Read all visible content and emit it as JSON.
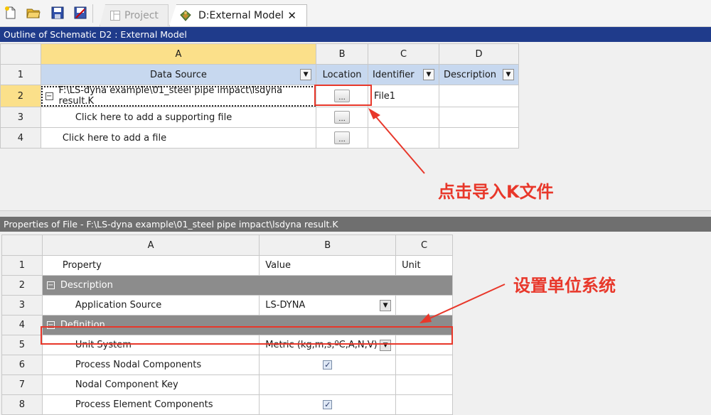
{
  "toolbar": {
    "icons": [
      "new-file-icon",
      "open-folder-icon",
      "save-icon",
      "import-icon"
    ]
  },
  "tabs": [
    {
      "label": "Project",
      "icon": "schematic-icon",
      "active": false
    },
    {
      "label": "D:External Model",
      "icon": "external-model-icon",
      "active": true,
      "close": "✕"
    }
  ],
  "outline": {
    "title": "Outline of Schematic D2 : External Model",
    "columns": [
      "A",
      "B",
      "C",
      "D"
    ],
    "row_numbers": [
      "1",
      "2",
      "3",
      "4"
    ],
    "headers": {
      "data_source": "Data Source",
      "location": "Location",
      "identifier": "Identifier",
      "description": "Description"
    },
    "rows": [
      {
        "data_source": "F:\\LS-dyna example\\01_steel pipe impact\\lsdyna result.K",
        "location": "...",
        "identifier": "File1"
      },
      {
        "data_source": "Click here to add a supporting file",
        "location": "..."
      },
      {
        "data_source": "Click here to add a file",
        "location": "..."
      }
    ]
  },
  "properties": {
    "title": "Properties of File - F:\\LS-dyna example\\01_steel pipe impact\\lsdyna result.K",
    "columns": [
      "A",
      "B",
      "C"
    ],
    "row_numbers": [
      "1",
      "2",
      "3",
      "4",
      "5",
      "6",
      "7",
      "8"
    ],
    "header": {
      "property": "Property",
      "value": "Value",
      "unit": "Unit"
    },
    "rows": [
      {
        "group": "Description"
      },
      {
        "property": "Application Source",
        "value": "LS-DYNA"
      },
      {
        "group": "Definition"
      },
      {
        "property": "Unit System",
        "value": "Metric (kg,m,s,ºC,A,N,V)"
      },
      {
        "property": "Process Nodal Components",
        "value": "checked"
      },
      {
        "property": "Nodal Component Key",
        "value": ""
      },
      {
        "property": "Process Element Components",
        "value": "checked"
      }
    ]
  },
  "annotations": {
    "import_k_file": "点击导入K文件",
    "set_unit_system": "设置单位系统",
    "color": "#e8372a"
  },
  "colors": {
    "panel_header": "#1f3b8b",
    "selected_row": "#fbe08a",
    "column_header": "#c7d8ef",
    "group_row": "#8c8c8c"
  }
}
